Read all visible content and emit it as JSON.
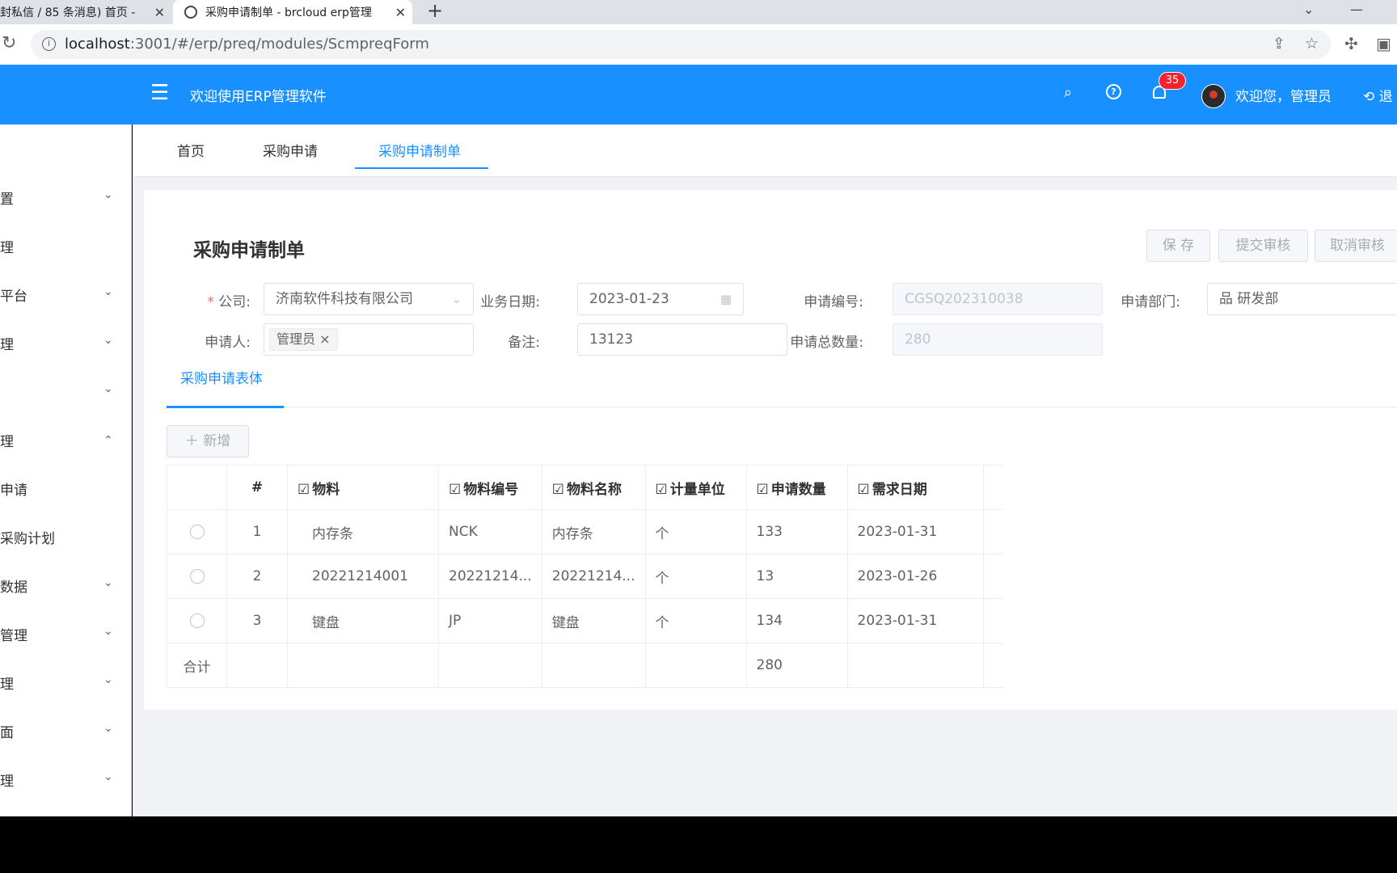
{
  "browser": {
    "tab_inactive": "封私信 / 85 条消息) 首页 -",
    "tab_active": "采购申请制单 - brcloud erp管理",
    "close_glyph": "✕",
    "new_tab_glyph": "+",
    "url_host": "localhost",
    "url_path": ":3001/#/erp/preq/modules/ScmpreqForm"
  },
  "header": {
    "title": "欢迎使用ERP管理软件",
    "notification_count": "35",
    "welcome": "欢迎您，管理员",
    "logout": "退"
  },
  "sidebar": {
    "items": [
      {
        "label": "置",
        "chevron": "⌄"
      },
      {
        "label": "理",
        "chevron": ""
      },
      {
        "label": "平台",
        "chevron": "⌄"
      },
      {
        "label": "理",
        "chevron": "⌄"
      },
      {
        "label": "",
        "chevron": "⌄"
      },
      {
        "label": "理",
        "chevron": "⌃"
      },
      {
        "label": "申请",
        "chevron": ""
      },
      {
        "label": "采购计划",
        "chevron": ""
      },
      {
        "label": "数据",
        "chevron": "⌄"
      },
      {
        "label": "管理",
        "chevron": "⌄"
      },
      {
        "label": "理",
        "chevron": "⌄"
      },
      {
        "label": "面",
        "chevron": "⌄"
      },
      {
        "label": "理",
        "chevron": "⌄"
      }
    ]
  },
  "nav_tabs": [
    "首页",
    "采购申请",
    "采购申请制单"
  ],
  "form": {
    "title": "采购申请制单",
    "buttons": {
      "save": "保 存",
      "submit": "提交审核",
      "cancel": "取消审核"
    },
    "required_mark": "*",
    "company_label": "公司:",
    "company_value": "济南软件科技有限公司",
    "date_label": "业务日期:",
    "date_value": "2023-01-23",
    "code_label": "申请编号:",
    "code_value": "CGSQ202310038",
    "dept_label": "申请部门:",
    "dept_value": "研发部",
    "applicant_label": "申请人:",
    "applicant_value": "管理员",
    "remark_label": "备注:",
    "remark_value": "13123",
    "total_label": "申请总数量:",
    "total_value": "280"
  },
  "subtab": "采购申请表体",
  "add_button": "新增",
  "table": {
    "edit_glyph": "☑",
    "headers": [
      "#",
      "物料",
      "物料编号",
      "物料名称",
      "计量单位",
      "申请数量",
      "需求日期"
    ],
    "rows": [
      {
        "no": "1",
        "material": "内存条",
        "code": "NCK",
        "name": "内存条",
        "unit": "个",
        "qty": "133",
        "date": "2023-01-31"
      },
      {
        "no": "2",
        "material": "20221214001",
        "code": "20221214...",
        "name": "20221214...",
        "unit": "个",
        "qty": "13",
        "date": "2023-01-26"
      },
      {
        "no": "3",
        "material": "键盘",
        "code": "JP",
        "name": "键盘",
        "unit": "个",
        "qty": "134",
        "date": "2023-01-31"
      }
    ],
    "total_label": "合计",
    "total_qty": "280"
  }
}
